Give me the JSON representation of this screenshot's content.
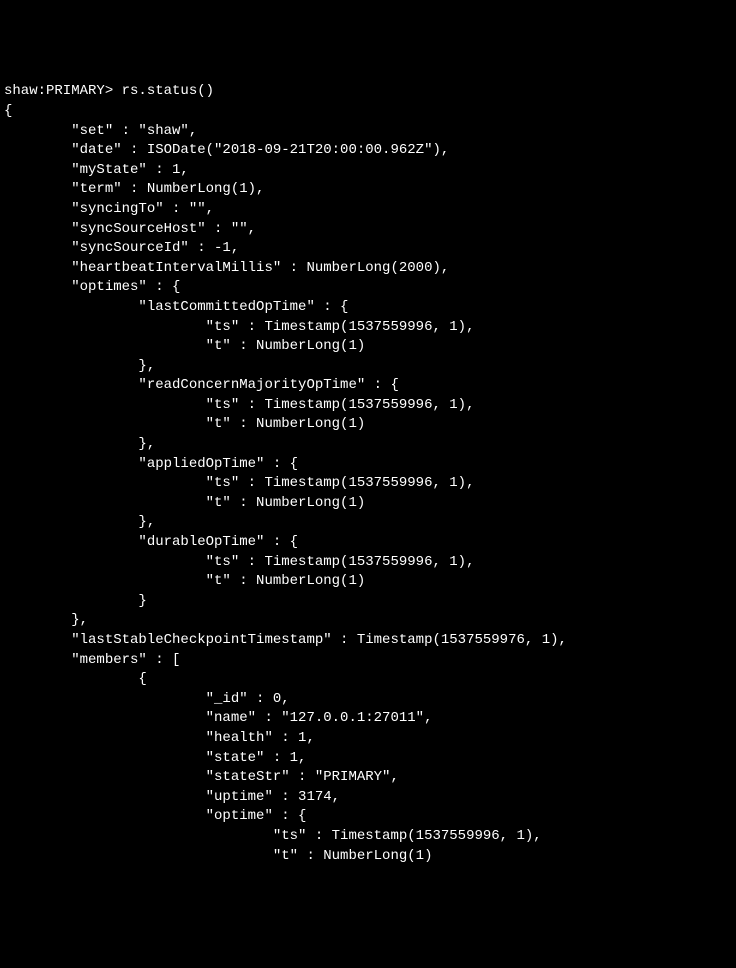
{
  "prompt": "shaw:PRIMARY> ",
  "command": "rs.status()",
  "output": {
    "openBrace": "{",
    "line_set": "        \"set\" : \"shaw\",",
    "line_date": "        \"date\" : ISODate(\"2018-09-21T20:00:00.962Z\"),",
    "line_myState": "        \"myState\" : 1,",
    "line_term": "        \"term\" : NumberLong(1),",
    "line_syncingTo": "        \"syncingTo\" : \"\",",
    "line_syncSourceHost": "        \"syncSourceHost\" : \"\",",
    "line_syncSourceId": "        \"syncSourceId\" : -1,",
    "line_heartbeatIntervalMillis": "        \"heartbeatIntervalMillis\" : NumberLong(2000),",
    "line_optimes_open": "        \"optimes\" : {",
    "line_lastCommittedOpTime_open": "                \"lastCommittedOpTime\" : {",
    "line_lastCommittedOpTime_ts": "                        \"ts\" : Timestamp(1537559996, 1),",
    "line_lastCommittedOpTime_t": "                        \"t\" : NumberLong(1)",
    "line_lastCommittedOpTime_close": "                },",
    "line_readConcernMajorityOpTime_open": "                \"readConcernMajorityOpTime\" : {",
    "line_readConcernMajorityOpTime_ts": "                        \"ts\" : Timestamp(1537559996, 1),",
    "line_readConcernMajorityOpTime_t": "                        \"t\" : NumberLong(1)",
    "line_readConcernMajorityOpTime_close": "                },",
    "line_appliedOpTime_open": "                \"appliedOpTime\" : {",
    "line_appliedOpTime_ts": "                        \"ts\" : Timestamp(1537559996, 1),",
    "line_appliedOpTime_t": "                        \"t\" : NumberLong(1)",
    "line_appliedOpTime_close": "                },",
    "line_durableOpTime_open": "                \"durableOpTime\" : {",
    "line_durableOpTime_ts": "                        \"ts\" : Timestamp(1537559996, 1),",
    "line_durableOpTime_t": "                        \"t\" : NumberLong(1)",
    "line_durableOpTime_close": "                }",
    "line_optimes_close": "        },",
    "line_lastStableCheckpointTimestamp": "        \"lastStableCheckpointTimestamp\" : Timestamp(1537559976, 1),",
    "line_members_open": "        \"members\" : [",
    "line_member0_open": "                {",
    "line_member0_id": "                        \"_id\" : 0,",
    "line_member0_name": "                        \"name\" : \"127.0.0.1:27011\",",
    "line_member0_health": "                        \"health\" : 1,",
    "line_member0_state": "                        \"state\" : 1,",
    "line_member0_stateStr": "                        \"stateStr\" : \"PRIMARY\",",
    "line_member0_uptime": "                        \"uptime\" : 3174,",
    "line_member0_optime_open": "                        \"optime\" : {",
    "line_member0_optime_ts": "                                \"ts\" : Timestamp(1537559996, 1),",
    "line_member0_optime_t": "                                \"t\" : NumberLong(1)"
  },
  "data": {
    "set": "shaw",
    "date": "2018-09-21T20:00:00.962Z",
    "myState": 1,
    "term": 1,
    "syncingTo": "",
    "syncSourceHost": "",
    "syncSourceId": -1,
    "heartbeatIntervalMillis": 2000,
    "optimes": {
      "lastCommittedOpTime": {
        "ts": [
          1537559996,
          1
        ],
        "t": 1
      },
      "readConcernMajorityOpTime": {
        "ts": [
          1537559996,
          1
        ],
        "t": 1
      },
      "appliedOpTime": {
        "ts": [
          1537559996,
          1
        ],
        "t": 1
      },
      "durableOpTime": {
        "ts": [
          1537559996,
          1
        ],
        "t": 1
      }
    },
    "lastStableCheckpointTimestamp": [
      1537559976,
      1
    ],
    "members": [
      {
        "_id": 0,
        "name": "127.0.0.1:27011",
        "health": 1,
        "state": 1,
        "stateStr": "PRIMARY",
        "uptime": 3174,
        "optime": {
          "ts": [
            1537559996,
            1
          ],
          "t": 1
        }
      }
    ]
  }
}
